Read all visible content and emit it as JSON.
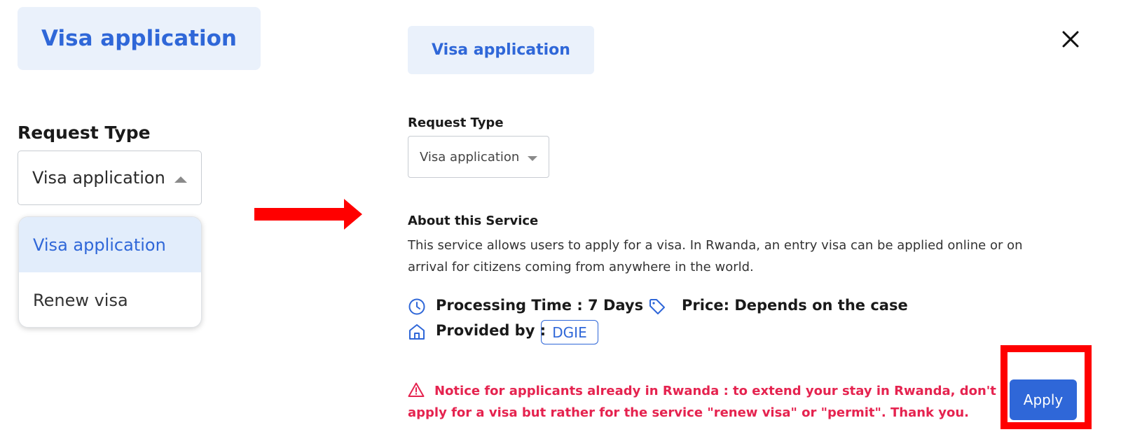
{
  "left_panel": {
    "tag_label": "Visa application",
    "request_type_label": "Request Type",
    "select_value": "Visa application",
    "dropdown_options": [
      "Visa application",
      "Renew visa"
    ],
    "selected_option": "Visa application"
  },
  "right_panel": {
    "tag_label": "Visa application",
    "request_type_label": "Request Type",
    "select_value": "Visa application",
    "about": {
      "title": "About this Service",
      "description": "This service allows users to apply for a visa. In Rwanda, an entry visa can be applied online or on arrival for citizens coming from anywhere in the world."
    },
    "processing_time": "Processing Time : 7 Days",
    "price": "Price: Depends on the case",
    "provided_by_label": "Provided by :",
    "provider": "DGIE",
    "notice": "Notice for applicants already in Rwanda : to extend your stay in Rwanda, don't apply for a visa but rather for the service \"renew visa\" or \"permit\". Thank you.",
    "apply_label": "Apply"
  },
  "icons": {
    "close": "close-icon",
    "clock": "clock-icon",
    "price_tag": "price-tag-icon",
    "home": "home-icon",
    "warning": "warning-icon",
    "caret_up": "caret-up-icon",
    "caret_down": "caret-down-icon",
    "arrow": "right-arrow-icon"
  },
  "colors": {
    "accent": "#2f67d8",
    "tag_background": "#eaf1fb",
    "selected_option_background": "#e2edfb",
    "notice": "#e5234f",
    "annotation": "#ff0000"
  }
}
